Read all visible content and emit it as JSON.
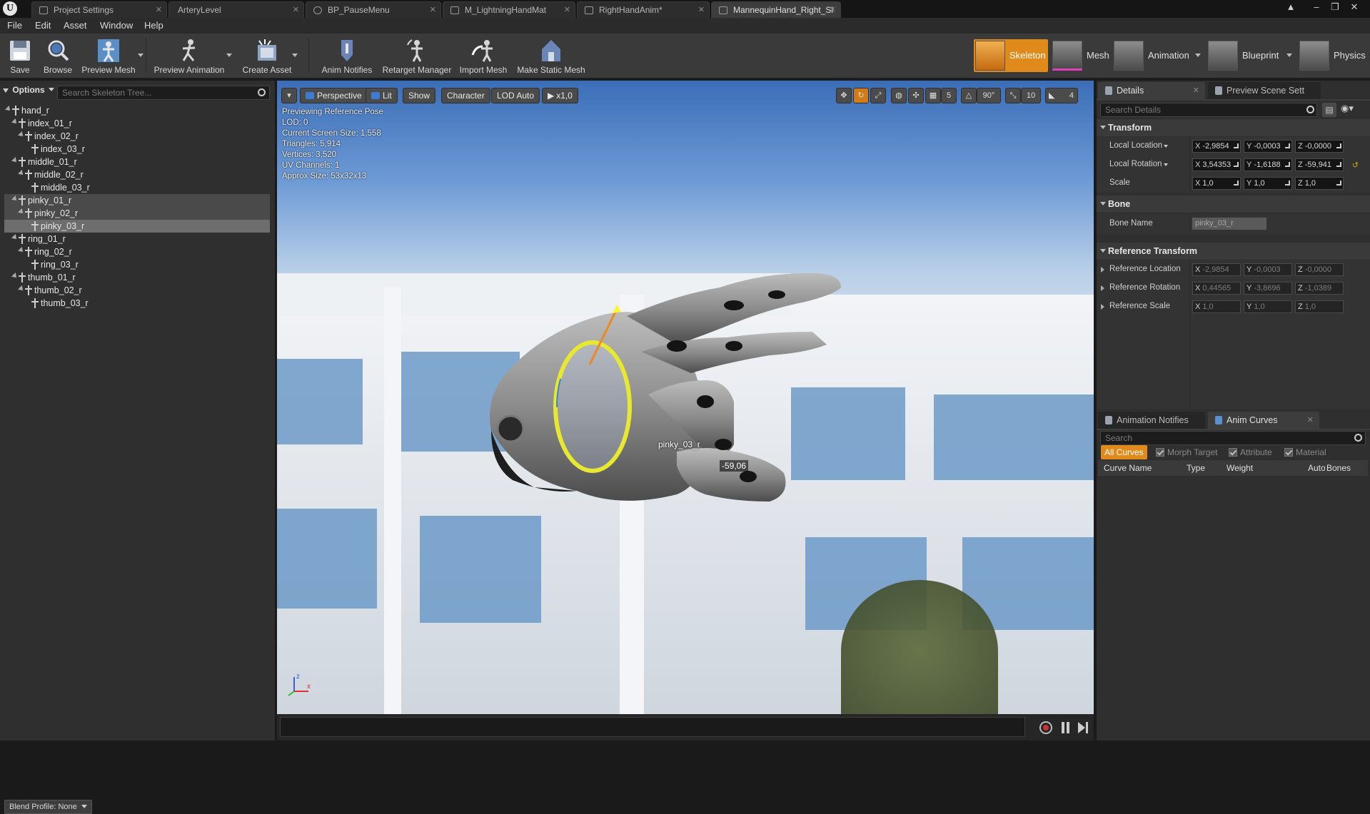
{
  "tabs": [
    {
      "label": "Project Settings"
    },
    {
      "label": "ArteryLevel"
    },
    {
      "label": "BP_PauseMenu"
    },
    {
      "label": "M_LightningHandMat"
    },
    {
      "label": "RightHandAnim*"
    },
    {
      "label": "MannequinHand_Right_Sl"
    }
  ],
  "menu": [
    "File",
    "Edit",
    "Asset",
    "Window",
    "Help"
  ],
  "toolbar": {
    "save": "Save",
    "browse": "Browse",
    "preview_mesh": "Preview Mesh",
    "preview_animation": "Preview Animation",
    "create_asset": "Create Asset",
    "anim_notifies": "Anim Notifies",
    "retarget_manager": "Retarget Manager",
    "import_mesh": "Import Mesh",
    "make_static_mesh": "Make Static Mesh"
  },
  "modes": {
    "skeleton": "Skeleton",
    "mesh": "Mesh",
    "animation": "Animation",
    "blueprint": "Blueprint",
    "physics": "Physics"
  },
  "skeleton_tree": {
    "options_label": "Options",
    "search_placeholder": "Search Skeleton Tree...",
    "bones": [
      {
        "name": "hand_r",
        "depth": 0
      },
      {
        "name": "index_01_r",
        "depth": 1
      },
      {
        "name": "index_02_r",
        "depth": 2
      },
      {
        "name": "index_03_r",
        "depth": 3
      },
      {
        "name": "middle_01_r",
        "depth": 1
      },
      {
        "name": "middle_02_r",
        "depth": 2
      },
      {
        "name": "middle_03_r",
        "depth": 3
      },
      {
        "name": "pinky_01_r",
        "depth": 1
      },
      {
        "name": "pinky_02_r",
        "depth": 2
      },
      {
        "name": "pinky_03_r",
        "depth": 3
      },
      {
        "name": "ring_01_r",
        "depth": 1
      },
      {
        "name": "ring_02_r",
        "depth": 2
      },
      {
        "name": "ring_03_r",
        "depth": 3
      },
      {
        "name": "thumb_01_r",
        "depth": 1
      },
      {
        "name": "thumb_02_r",
        "depth": 2
      },
      {
        "name": "thumb_03_r",
        "depth": 3
      }
    ],
    "blend_profile": "Blend Profile: None"
  },
  "viewport": {
    "buttons": {
      "perspective": "Perspective",
      "lit": "Lit",
      "show": "Show",
      "character": "Character",
      "lod": "LOD Auto",
      "speed": "x1,0"
    },
    "right_controls": {
      "grid_snap": "5",
      "angle_snap": "90°",
      "scale_snap": "10",
      "camera_speed": "4"
    },
    "stats": [
      "Previewing Reference Pose",
      "LOD: 0",
      "Current Screen Size: 1,558",
      "Triangles: 5,914",
      "Vertices: 3,520",
      "UV Channels: 1",
      "Approx Size: 53x32x13"
    ],
    "bone_label": "pinky_03_r",
    "rotation_readout": "-59,06"
  },
  "details": {
    "tab_details": "Details",
    "tab_preview": "Preview Scene Sett",
    "search_placeholder": "Search Details",
    "transform_header": "Transform",
    "local_location": {
      "label": "Local Location",
      "x": "-2,9854",
      "y": "-0,0003",
      "z": "-0,0000"
    },
    "local_rotation": {
      "label": "Local Rotation",
      "x": "3,54353",
      "y": "-1,6188",
      "z": "-59,941"
    },
    "scale": {
      "label": "Scale",
      "x": "1,0",
      "y": "1,0",
      "z": "1,0"
    },
    "bone_header": "Bone",
    "bone_name_label": "Bone Name",
    "bone_name_value": "pinky_03_r",
    "ref_header": "Reference Transform",
    "ref_location": {
      "label": "Reference Location",
      "x": "-2,9854",
      "y": "-0,0003",
      "z": "-0,0000"
    },
    "ref_rotation": {
      "label": "Reference Rotation",
      "x": "0,44565",
      "y": "-3,8696",
      "z": "-1,0389"
    },
    "ref_scale": {
      "label": "Reference Scale",
      "x": "1,0",
      "y": "1,0",
      "z": "1,0"
    }
  },
  "curves": {
    "tab_notifies": "Animation Notifies",
    "tab_curves": "Anim Curves",
    "search_placeholder": "Search",
    "filters": {
      "all": "All Curves",
      "morph": "Morph Target",
      "attribute": "Attribute",
      "material": "Material"
    },
    "columns": {
      "name": "Curve Name",
      "type": "Type",
      "weight": "Weight",
      "auto": "Auto",
      "bones": "Bones"
    }
  },
  "colors": {
    "accent": "#e08a1c",
    "selection": "#6d6d6d",
    "panel": "#2f2f2f"
  }
}
